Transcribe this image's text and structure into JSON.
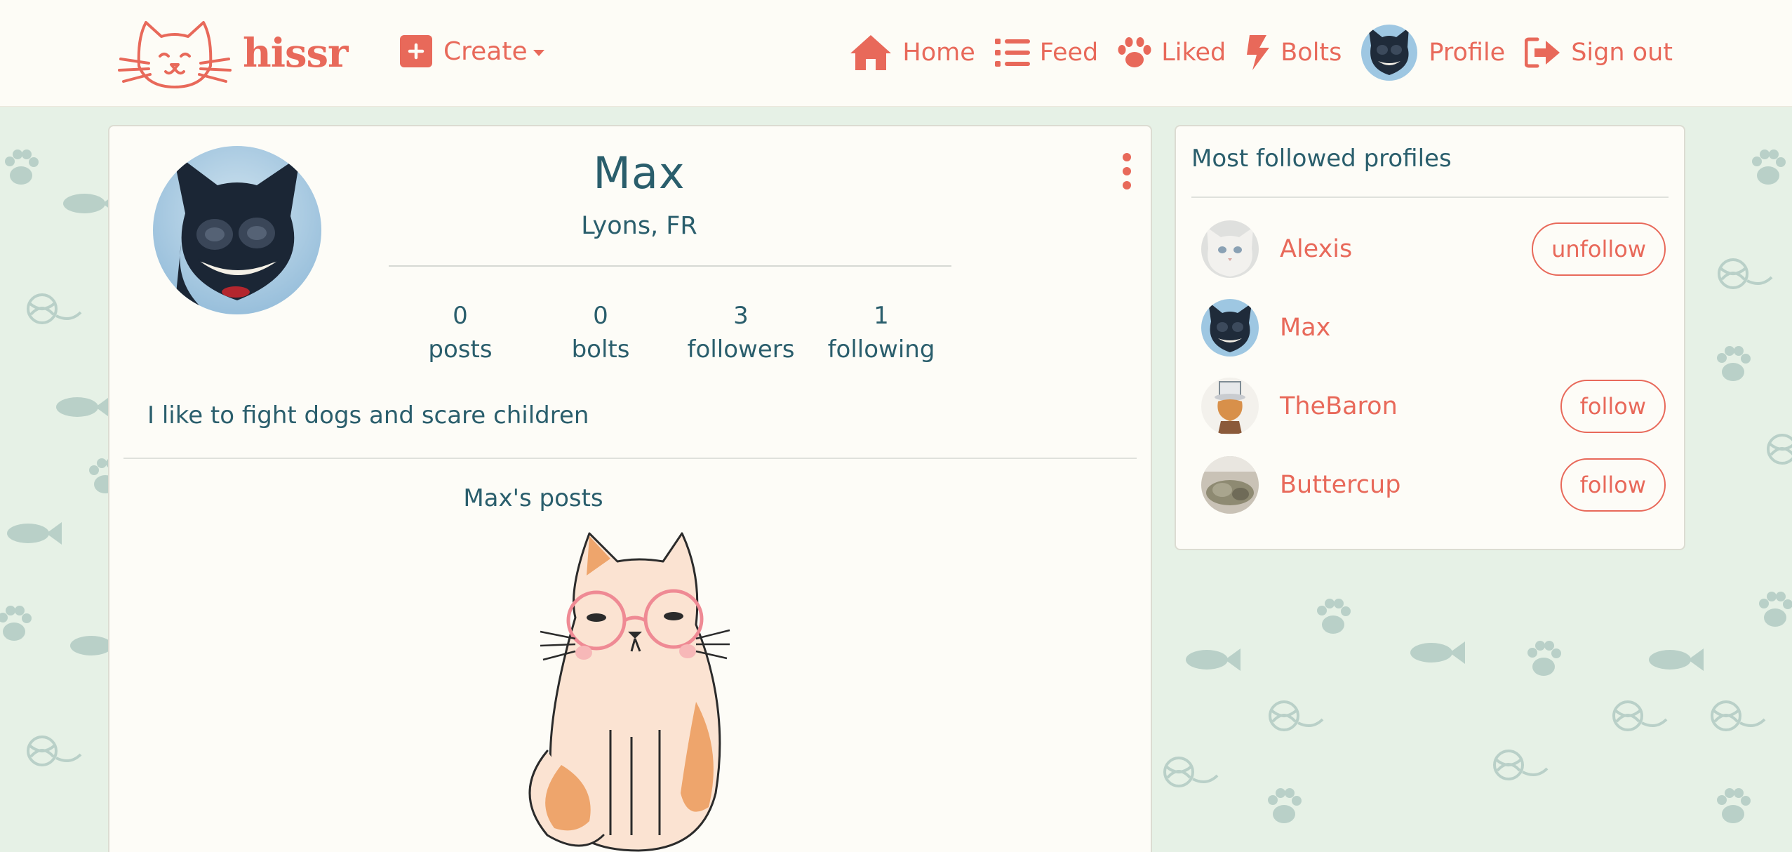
{
  "navbar": {
    "brand": "hissr",
    "create_label": "Create",
    "links": {
      "home": "Home",
      "feed": "Feed",
      "liked": "Liked",
      "bolts": "Bolts",
      "profile": "Profile",
      "signout": "Sign out"
    }
  },
  "profile": {
    "name": "Max",
    "location": "Lyons, FR",
    "stats": [
      {
        "value": "0",
        "label": "posts"
      },
      {
        "value": "0",
        "label": "bolts"
      },
      {
        "value": "3",
        "label": "followers"
      },
      {
        "value": "1",
        "label": "following"
      }
    ],
    "bio": "I like to fight dogs and scare children",
    "posts_heading": "Max's posts"
  },
  "sidebar": {
    "title": "Most followed profiles",
    "profiles": [
      {
        "name": "Alexis",
        "button": "unfollow"
      },
      {
        "name": "Max",
        "button": ""
      },
      {
        "name": "TheBaron",
        "button": "follow"
      },
      {
        "name": "Buttercup",
        "button": "follow"
      }
    ]
  },
  "colors": {
    "accent": "#e8695a",
    "text": "#2a5e6c",
    "background": "#e6f1e6",
    "card": "#fdfcf7",
    "navbar": "#fdfcf6"
  },
  "icons": {
    "brand": "cat-face-logo",
    "create": "plus-square-icon",
    "home": "house-icon",
    "feed": "list-icon",
    "liked": "paw-icon",
    "bolts": "bolt-icon",
    "signout": "sign-out-icon",
    "menu": "kebab-menu-icon"
  }
}
